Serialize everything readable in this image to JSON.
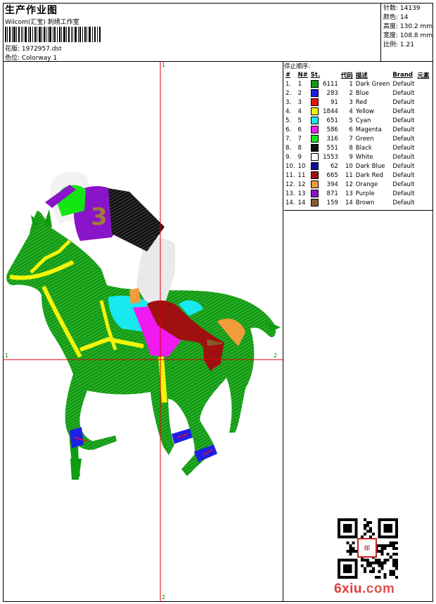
{
  "header": {
    "title": "生产作业图",
    "company": "Wilcom(汇宝) 刺绣工作室",
    "design_label": "花版: 1972957.dst",
    "colorway_label": "色位: Colorway 1"
  },
  "stats": {
    "stitches": "针数: 14139",
    "colors": "颜色: 14",
    "height": "高度: 130.2 mm",
    "width": "宽度: 108.8 mm",
    "scale": "比例: 1.21"
  },
  "axis_labels": {
    "top": "1",
    "bottom": "2",
    "left": "1",
    "right": "2"
  },
  "stop_sequence": {
    "title": "停止顺序:",
    "headers": [
      "#",
      "N#",
      "St.",
      "代码",
      "描述",
      "Brand",
      "元素"
    ],
    "rows": [
      {
        "idx": "1.",
        "n": "1",
        "color": "#109c10",
        "st": "6111",
        "code": "1",
        "desc": "Dark Green",
        "brand": "Default"
      },
      {
        "idx": "2.",
        "n": "2",
        "color": "#1f1fe8",
        "st": "283",
        "code": "2",
        "desc": "Blue",
        "brand": "Default"
      },
      {
        "idx": "3.",
        "n": "3",
        "color": "#ee1010",
        "st": "91",
        "code": "3",
        "desc": "Red",
        "brand": "Default"
      },
      {
        "idx": "4.",
        "n": "4",
        "color": "#f4f40a",
        "st": "1844",
        "code": "4",
        "desc": "Yellow",
        "brand": "Default"
      },
      {
        "idx": "5.",
        "n": "5",
        "color": "#18e8f0",
        "st": "651",
        "code": "5",
        "desc": "Cyan",
        "brand": "Default"
      },
      {
        "idx": "6.",
        "n": "6",
        "color": "#f01af0",
        "st": "586",
        "code": "6",
        "desc": "Magenta",
        "brand": "Default"
      },
      {
        "idx": "7.",
        "n": "7",
        "color": "#13e613",
        "st": "316",
        "code": "7",
        "desc": "Green",
        "brand": "Default"
      },
      {
        "idx": "8.",
        "n": "8",
        "color": "#111111",
        "st": "551",
        "code": "8",
        "desc": "Black",
        "brand": "Default"
      },
      {
        "idx": "9.",
        "n": "9",
        "color": "#ffffff",
        "st": "1553",
        "code": "9",
        "desc": "White",
        "brand": "Default"
      },
      {
        "idx": "10.",
        "n": "10",
        "color": "#0c0ca0",
        "st": "62",
        "code": "10",
        "desc": "Dark Blue",
        "brand": "Default"
      },
      {
        "idx": "11.",
        "n": "11",
        "color": "#a01010",
        "st": "665",
        "code": "11",
        "desc": "Dark Red",
        "brand": "Default"
      },
      {
        "idx": "12.",
        "n": "12",
        "color": "#f29b3a",
        "st": "394",
        "code": "12",
        "desc": "Orange",
        "brand": "Default"
      },
      {
        "idx": "13.",
        "n": "13",
        "color": "#8a14c8",
        "st": "871",
        "code": "13",
        "desc": "Purple",
        "brand": "Default"
      },
      {
        "idx": "14.",
        "n": "14",
        "color": "#8a5a2a",
        "st": "159",
        "code": "14",
        "desc": "Brown",
        "brand": "Default"
      }
    ]
  },
  "watermark": {
    "prefix": "6xiu",
    "suffix": ".com",
    "seal_text": "印"
  },
  "design_colors": {
    "horse": "#109c10",
    "blue": "#1f1fe8",
    "red": "#ee1010",
    "yellow": "#f4f40a",
    "cyan": "#18e8f0",
    "magenta": "#f01af0",
    "green": "#13e613",
    "black": "#111111",
    "white": "#f2f2f2",
    "darkred": "#a01010",
    "orange": "#f29b3a",
    "purple": "#8a14c8",
    "brown": "#8a5a2a",
    "axis": "#e00000"
  }
}
